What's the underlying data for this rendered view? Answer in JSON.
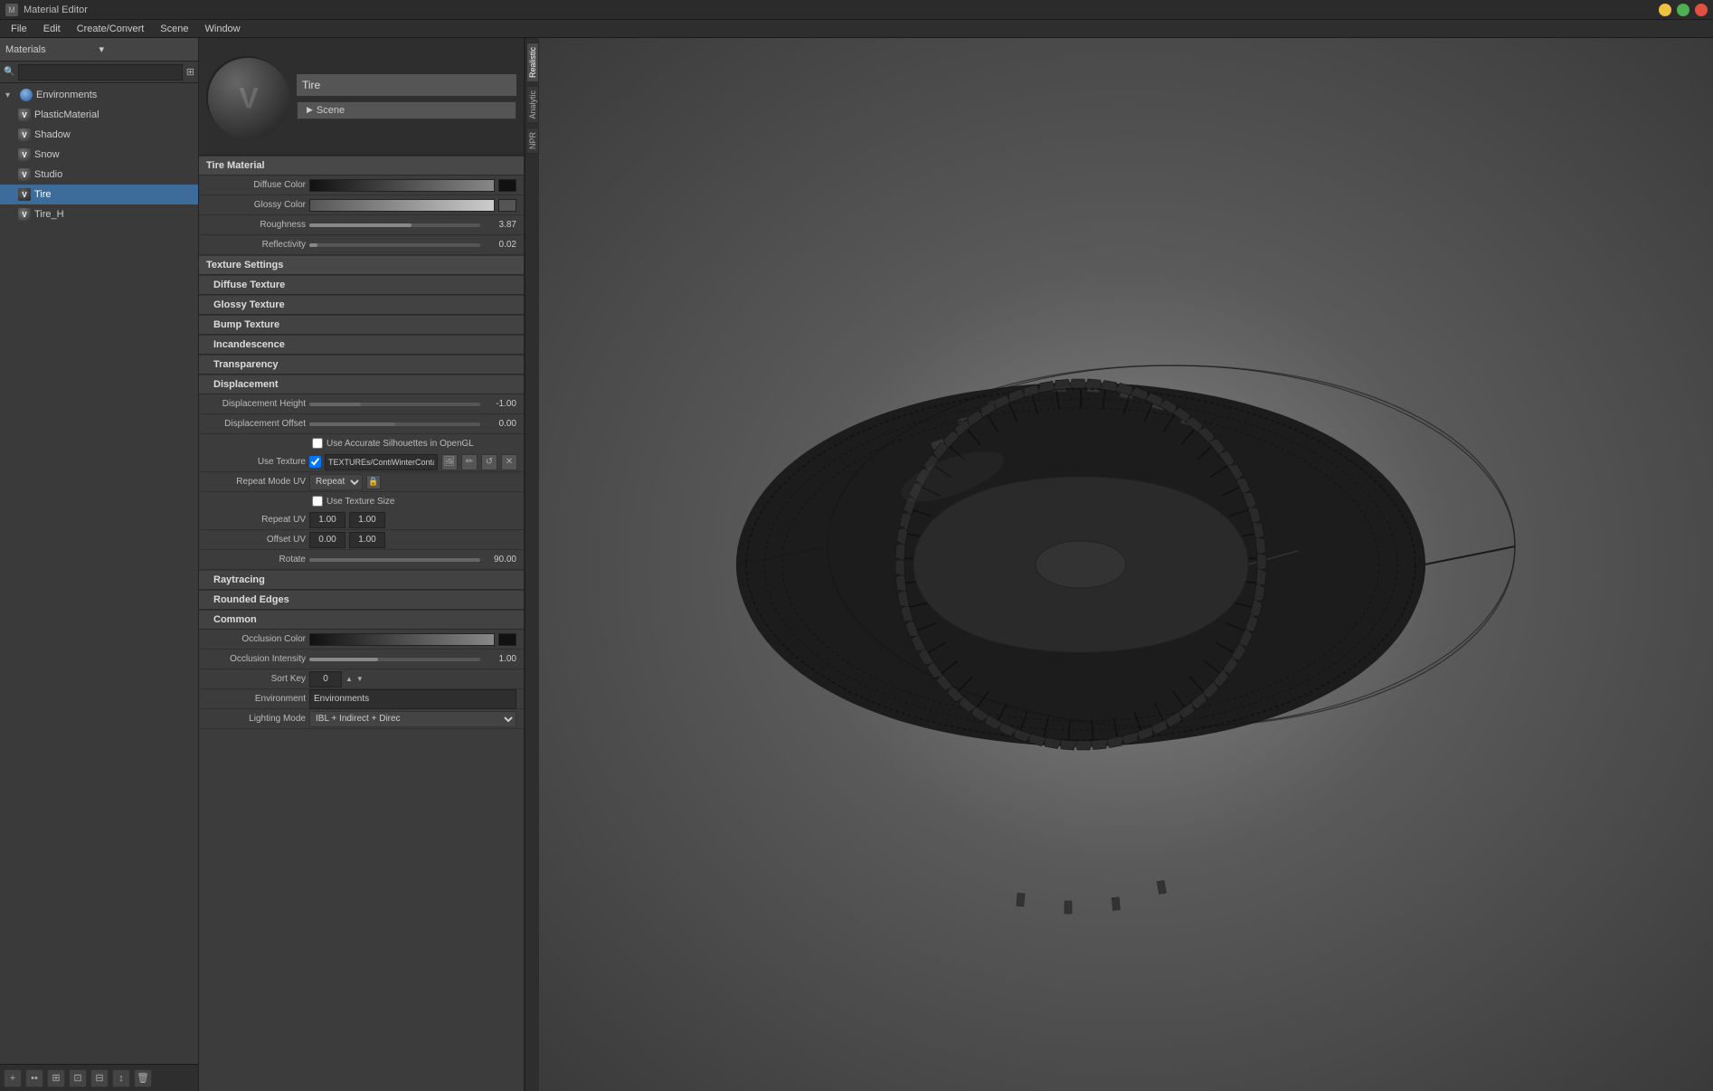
{
  "titlebar": {
    "title": "Material Editor",
    "icon": "M"
  },
  "menubar": {
    "items": [
      "File",
      "Edit",
      "Create/Convert",
      "Scene",
      "Window"
    ]
  },
  "leftpanel": {
    "dropdown": "Materials",
    "search_placeholder": "",
    "tree": [
      {
        "id": "environments",
        "label": "Environments",
        "type": "env",
        "indent": 0,
        "expanded": true
      },
      {
        "id": "plasticmaterial",
        "label": "PlasticMaterial",
        "type": "mat",
        "indent": 1
      },
      {
        "id": "shadow",
        "label": "Shadow",
        "type": "mat",
        "indent": 1
      },
      {
        "id": "snow",
        "label": "Snow",
        "type": "mat",
        "indent": 1
      },
      {
        "id": "studio",
        "label": "Studio",
        "type": "mat",
        "indent": 1
      },
      {
        "id": "tire",
        "label": "Tire",
        "type": "mat",
        "indent": 1,
        "active": true
      },
      {
        "id": "tire_h",
        "label": "Tire_H",
        "type": "mat",
        "indent": 1
      }
    ],
    "toolbar_buttons": [
      "+",
      "••",
      "⊞",
      "⊡",
      "⊟",
      "↕",
      "🗑"
    ]
  },
  "preview": {
    "name": "Tire",
    "scene_btn": "Scene"
  },
  "material": {
    "section_title": "Tire Material",
    "diffuse_color_label": "Diffuse Color",
    "glossy_color_label": "Glossy Color",
    "roughness_label": "Roughness",
    "roughness_value": "3.87",
    "reflectivity_label": "Reflectivity",
    "reflectivity_value": "0.02"
  },
  "texture_settings": {
    "title": "Texture Settings"
  },
  "diffuse_texture": {
    "title": "Diffuse Texture"
  },
  "glossy_texture": {
    "title": "Glossy Texture"
  },
  "bump_texture": {
    "title": "Bump Texture"
  },
  "incandescence": {
    "title": "Incandescence"
  },
  "transparency": {
    "title": "Transparency"
  },
  "displacement": {
    "title": "Displacement",
    "height_label": "Displacement Height",
    "height_value": "-1.00",
    "offset_label": "Displacement Offset",
    "offset_value": "0.00",
    "use_accurate": "Use Accurate Silhouettes in OpenGL",
    "use_texture": "Use Texture",
    "texture_path": "TEXTUREs/ContiWinterContact_R.btf",
    "repeat_mode_label": "Repeat Mode UV",
    "repeat_mode": "Repeat",
    "use_texture_size": "Use Texture Size",
    "repeat_uv_label": "Repeat UV",
    "repeat_uv_x": "1.00",
    "repeat_uv_y": "1.00",
    "offset_uv_label": "Offset UV",
    "offset_uv_x": "0.00",
    "offset_uv_y": "1.00",
    "rotate_label": "Rotate",
    "rotate_value": "90.00"
  },
  "raytracing": {
    "title": "Raytracing"
  },
  "rounded_edges": {
    "title": "Rounded Edges"
  },
  "common": {
    "title": "Common",
    "occlusion_color_label": "Occlusion Color",
    "occlusion_intensity_label": "Occlusion Intensity",
    "occlusion_intensity_value": "1.00",
    "sort_key_label": "Sort Key",
    "sort_key_value": "0",
    "environment_label": "Environment",
    "environment_value": "Environments",
    "lighting_mode_label": "Lighting Mode",
    "lighting_mode_value": "IBL + Indirect + Direc"
  },
  "render_tabs": [
    {
      "label": "Realistic",
      "active": true
    },
    {
      "label": "Analytic"
    },
    {
      "label": "NPR"
    }
  ],
  "viewport": {
    "background": "gray"
  }
}
